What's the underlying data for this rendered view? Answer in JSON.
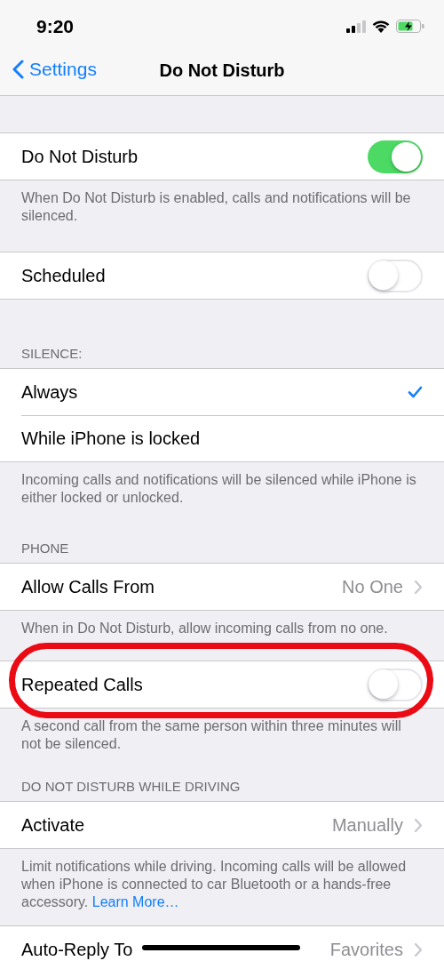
{
  "status_bar": {
    "time": "9:20"
  },
  "nav": {
    "back": "Settings",
    "title": "Do Not Disturb"
  },
  "sections": [
    {
      "rows": [
        {
          "kind": "toggle",
          "label": "Do Not Disturb",
          "on": true
        }
      ],
      "footer": "When Do Not Disturb is enabled, calls and notifications will be silenced."
    },
    {
      "rows": [
        {
          "kind": "toggle",
          "label": "Scheduled",
          "on": false
        }
      ]
    },
    {
      "header": "SILENCE:",
      "rows": [
        {
          "kind": "check",
          "label": "Always",
          "selected": true
        },
        {
          "kind": "check",
          "label": "While iPhone is locked",
          "selected": false
        }
      ],
      "footer": "Incoming calls and notifications will be silenced while iPhone is either locked or unlocked."
    },
    {
      "header": "PHONE",
      "rows": [
        {
          "kind": "disclosure",
          "label": "Allow Calls From",
          "value": "No One"
        }
      ],
      "footer": "When in Do Not Disturb, allow incoming calls from no one."
    },
    {
      "rows": [
        {
          "kind": "toggle",
          "label": "Repeated Calls",
          "on": false,
          "highlighted": true
        }
      ],
      "footer": "A second call from the same person within three minutes will not be silenced."
    },
    {
      "header": "DO NOT DISTURB WHILE DRIVING",
      "rows": [
        {
          "kind": "disclosure",
          "label": "Activate",
          "value": "Manually"
        }
      ],
      "footer": "Limit notifications while driving. Incoming calls will be allowed when iPhone is connected to car Bluetooth or a hands-free accessory. ",
      "footer_link": "Learn More…"
    },
    {
      "rows": [
        {
          "kind": "disclosure",
          "label": "Auto-Reply To",
          "value": "Favorites"
        }
      ]
    }
  ]
}
